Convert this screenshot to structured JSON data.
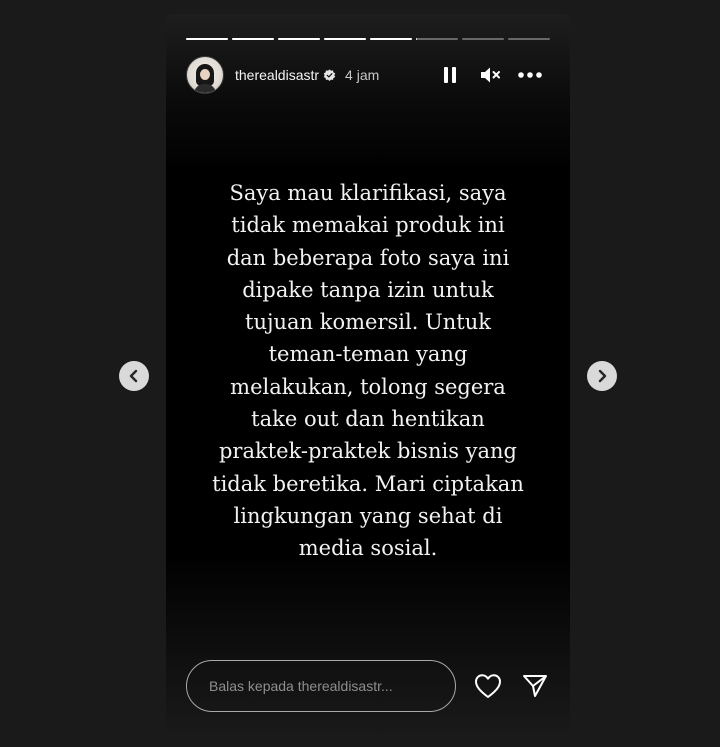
{
  "story": {
    "progress": {
      "segments": [
        1,
        1,
        1,
        1,
        1,
        0,
        0,
        0
      ],
      "current_index": 5,
      "current_fill": 0.02
    },
    "header": {
      "username": "therealdisastr",
      "verified": true,
      "time_ago": "4 jam",
      "avatar_icon": "avatar-image"
    },
    "controls": {
      "pause_icon": "pause-icon",
      "mute_icon": "muted-speaker-icon",
      "more_icon": "more-options-icon"
    },
    "text": "Saya mau klarifikasi, saya\ntidak memakai produk ini\ndan beberapa foto saya ini\ndipake tanpa izin untuk\ntujuan komersil. Untuk\nteman-teman yang\nmelakukan, tolong segera\ntake out dan hentikan\npraktek-praktek bisnis yang\ntidak beretika. Mari ciptakan\nlingkungan yang sehat di\nmedia sosial.",
    "reply": {
      "placeholder": "Balas kepada therealdisastr...",
      "value": "",
      "like_icon": "heart-icon",
      "send_icon": "send-icon"
    }
  },
  "navigation": {
    "prev_icon": "chevron-left-icon",
    "next_icon": "chevron-right-icon"
  },
  "colors": {
    "page_background": "#1a1a1a",
    "story_background": "#000000",
    "text": "#f2f2f2",
    "progress_active": "#ffffff",
    "progress_inactive": "rgba(255,255,255,0.35)"
  }
}
